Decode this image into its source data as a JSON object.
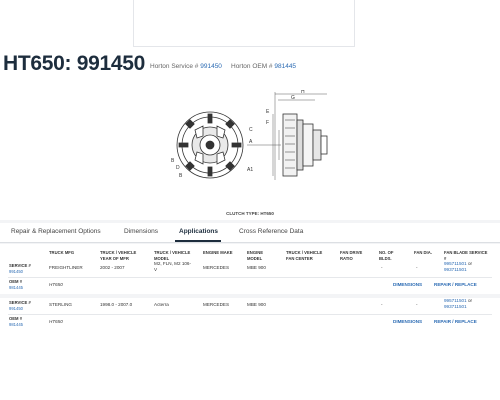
{
  "page": {
    "title": "HT650: 991450",
    "service_label": "Horton Service #",
    "service_number": "991450",
    "oem_label": "Horton OEM #",
    "oem_number": "981445"
  },
  "diagram": {
    "letters": [
      "H",
      "G",
      "E",
      "F",
      "C",
      "A",
      "A1",
      "B",
      "D",
      "B"
    ],
    "caption": "CLUTCH TYPE: HT650"
  },
  "tabs": [
    {
      "label": "Repair & Replacement Options",
      "active": false
    },
    {
      "label": "Dimensions",
      "active": false
    },
    {
      "label": "Applications",
      "active": true
    },
    {
      "label": "Cross Reference Data",
      "active": false
    }
  ],
  "table": {
    "headers": {
      "truck_mfg": "TRUCK MFG",
      "year": "TRUCK / VEHICLE YEAR OF MFR",
      "model": "TRUCK / VEHICLE MODEL",
      "engine_make": "ENGINE MAKE",
      "engine_model": "ENGINE MODEL",
      "fan_center": "TRUCK / VEHICLE FAN CENTER",
      "fan_drive_ratio": "FAN DRIVE RATIO",
      "blds": "NO. OF BLDS.",
      "fan_dia": "FAN DIA.",
      "fan_blade": "FAN BLADE SERVICE #"
    },
    "row_labels": {
      "service": "SERVICE #",
      "oem": "OEM #"
    },
    "rows": [
      {
        "service_no": "991450",
        "oem_no": "981445",
        "truck_mfg": "FREIGHTLINER",
        "year": "2002 - 2007",
        "model": "M2, FLN, M2 106-V",
        "engine_make": "MERCEDES",
        "engine_model": "MBE 900",
        "blds": "-",
        "fan_dia": "-",
        "fan_blade_1": "995711501",
        "fan_blade_or": "or",
        "fan_blade_2": "993711501",
        "clutch": "HT650",
        "dimensions": "DIMENSIONS",
        "repair": "REPAIR / REPLACE"
      },
      {
        "service_no": "991450",
        "oem_no": "981445",
        "truck_mfg": "STERLING",
        "year": "1998.0 - 2007.0",
        "model": "Acterra",
        "engine_make": "MERCEDES",
        "engine_model": "MBE 900",
        "blds": "-",
        "fan_dia": "-",
        "fan_blade_1": "995711501",
        "fan_blade_or": "or",
        "fan_blade_2": "993711501",
        "clutch": "HT650",
        "dimensions": "DIMENSIONS",
        "repair": "REPAIR / REPLACE"
      }
    ]
  }
}
